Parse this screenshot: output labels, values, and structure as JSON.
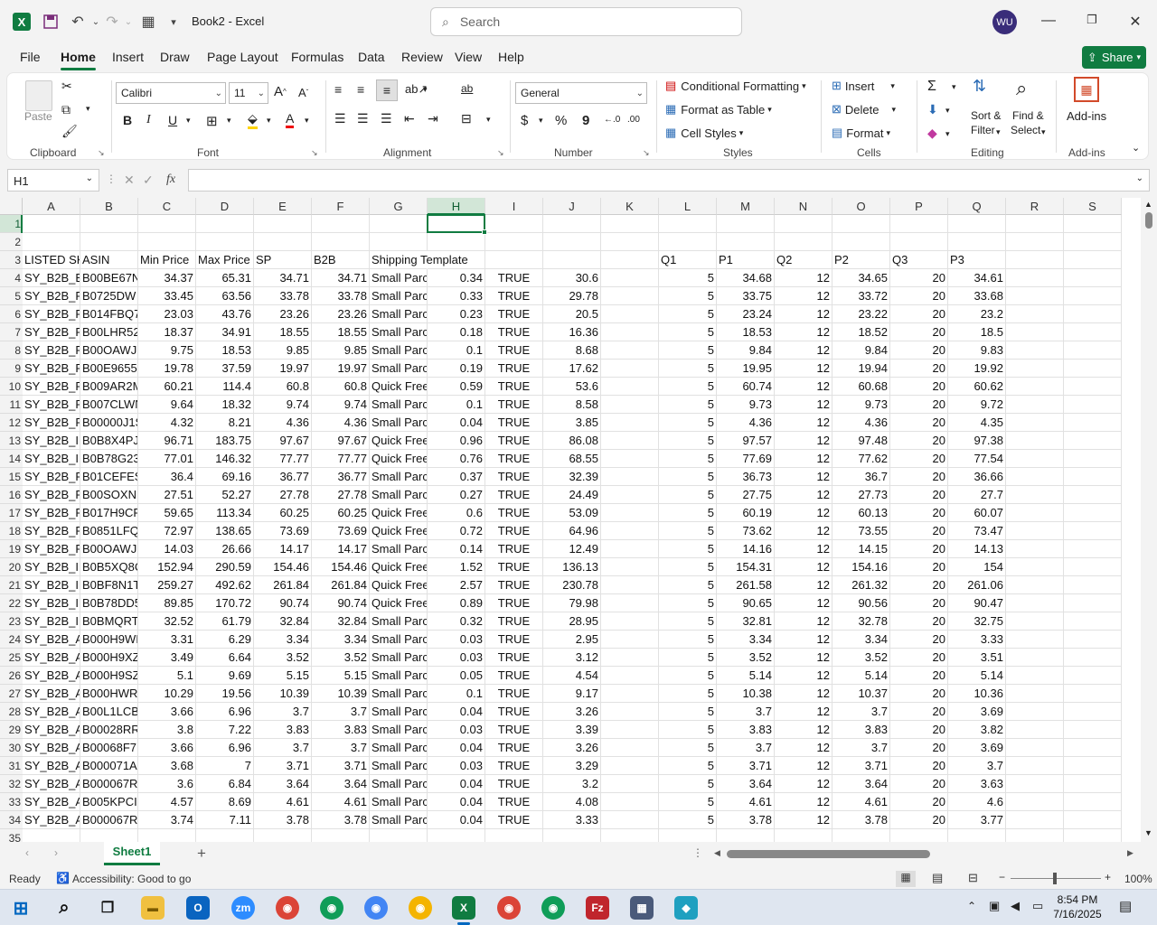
{
  "window": {
    "title": "Book2  -  Excel",
    "avatar": "WU"
  },
  "search": {
    "placeholder": "Search"
  },
  "menu": [
    "File",
    "Home",
    "Insert",
    "Draw",
    "Page Layout",
    "Formulas",
    "Data",
    "Review",
    "View",
    "Help"
  ],
  "share": "Share",
  "ribbon": {
    "clipboard": {
      "paste": "Paste",
      "label": "Clipboard"
    },
    "font": {
      "name": "Calibri",
      "size": "11",
      "label": "Font"
    },
    "alignment": {
      "label": "Alignment"
    },
    "number": {
      "format": "General",
      "label": "Number"
    },
    "styles": {
      "cond": "Conditional Formatting",
      "table": "Format as Table",
      "cell": "Cell Styles",
      "label": "Styles"
    },
    "cells": {
      "insert": "Insert",
      "delete": "Delete",
      "format": "Format",
      "label": "Cells"
    },
    "editing": {
      "sort": "Sort &",
      "sort2": "Filter",
      "find": "Find &",
      "find2": "Select",
      "label": "Editing"
    },
    "addins": {
      "btn": "Add-ins",
      "label": "Add-ins"
    }
  },
  "namebox": "H1",
  "columns": [
    "A",
    "B",
    "C",
    "D",
    "E",
    "F",
    "G",
    "H",
    "I",
    "J",
    "K",
    "L",
    "M",
    "N",
    "O",
    "P",
    "Q",
    "R",
    "S"
  ],
  "header_row": {
    "A": "LISTED SKU",
    "B": "ASIN",
    "C": "Min Price",
    "D": "Max Price",
    "E": "SP",
    "F": "B2B",
    "G": "Shipping Template",
    "L": "Q1",
    "M": "P1",
    "N": "Q2",
    "O": "P2",
    "P": "Q3",
    "Q": "P3"
  },
  "rows": [
    [
      "SY_B2B_B",
      "B00BE67N",
      "34.37",
      "65.31",
      "34.71",
      "34.71",
      "Small Parc",
      "0.34",
      "TRUE",
      "30.6",
      "",
      "5",
      "34.68",
      "12",
      "34.65",
      "20",
      "34.61"
    ],
    [
      "SY_B2B_F",
      "B0725DW",
      "33.45",
      "63.56",
      "33.78",
      "33.78",
      "Small Parc",
      "0.33",
      "TRUE",
      "29.78",
      "",
      "5",
      "33.75",
      "12",
      "33.72",
      "20",
      "33.68"
    ],
    [
      "SY_B2B_F",
      "B014FBQ7",
      "23.03",
      "43.76",
      "23.26",
      "23.26",
      "Small Parc",
      "0.23",
      "TRUE",
      "20.5",
      "",
      "5",
      "23.24",
      "12",
      "23.22",
      "20",
      "23.2"
    ],
    [
      "SY_B2B_F",
      "B00LHR52",
      "18.37",
      "34.91",
      "18.55",
      "18.55",
      "Small Parc",
      "0.18",
      "TRUE",
      "16.36",
      "",
      "5",
      "18.53",
      "12",
      "18.52",
      "20",
      "18.5"
    ],
    [
      "SY_B2B_F",
      "B00OAWJ",
      "9.75",
      "18.53",
      "9.85",
      "9.85",
      "Small Parc",
      "0.1",
      "TRUE",
      "8.68",
      "",
      "5",
      "9.84",
      "12",
      "9.84",
      "20",
      "9.83"
    ],
    [
      "SY_B2B_F",
      "B00E9655",
      "19.78",
      "37.59",
      "19.97",
      "19.97",
      "Small Parc",
      "0.19",
      "TRUE",
      "17.62",
      "",
      "5",
      "19.95",
      "12",
      "19.94",
      "20",
      "19.92"
    ],
    [
      "SY_B2B_F",
      "B009AR2M",
      "60.21",
      "114.4",
      "60.8",
      "60.8",
      "Quick Free",
      "0.59",
      "TRUE",
      "53.6",
      "",
      "5",
      "60.74",
      "12",
      "60.68",
      "20",
      "60.62"
    ],
    [
      "SY_B2B_F",
      "B007CLWN",
      "9.64",
      "18.32",
      "9.74",
      "9.74",
      "Small Parc",
      "0.1",
      "TRUE",
      "8.58",
      "",
      "5",
      "9.73",
      "12",
      "9.73",
      "20",
      "9.72"
    ],
    [
      "SY_B2B_F",
      "B00000J1S",
      "4.32",
      "8.21",
      "4.36",
      "4.36",
      "Small Parc",
      "0.04",
      "TRUE",
      "3.85",
      "",
      "5",
      "4.36",
      "12",
      "4.36",
      "20",
      "4.35"
    ],
    [
      "SY_B2B_IN",
      "B0B8X4PJ",
      "96.71",
      "183.75",
      "97.67",
      "97.67",
      "Quick Free",
      "0.96",
      "TRUE",
      "86.08",
      "",
      "5",
      "97.57",
      "12",
      "97.48",
      "20",
      "97.38"
    ],
    [
      "SY_B2B_IN",
      "B0B78G23",
      "77.01",
      "146.32",
      "77.77",
      "77.77",
      "Quick Free",
      "0.76",
      "TRUE",
      "68.55",
      "",
      "5",
      "77.69",
      "12",
      "77.62",
      "20",
      "77.54"
    ],
    [
      "SY_B2B_F",
      "B01CEFESI",
      "36.4",
      "69.16",
      "36.77",
      "36.77",
      "Small Parc",
      "0.37",
      "TRUE",
      "32.39",
      "",
      "5",
      "36.73",
      "12",
      "36.7",
      "20",
      "36.66"
    ],
    [
      "SY_B2B_F",
      "B00SOXN1",
      "27.51",
      "52.27",
      "27.78",
      "27.78",
      "Small Parc",
      "0.27",
      "TRUE",
      "24.49",
      "",
      "5",
      "27.75",
      "12",
      "27.73",
      "20",
      "27.7"
    ],
    [
      "SY_B2B_F",
      "B017H9CF",
      "59.65",
      "113.34",
      "60.25",
      "60.25",
      "Quick Free",
      "0.6",
      "TRUE",
      "53.09",
      "",
      "5",
      "60.19",
      "12",
      "60.13",
      "20",
      "60.07"
    ],
    [
      "SY_B2B_F",
      "B0851LFQ",
      "72.97",
      "138.65",
      "73.69",
      "73.69",
      "Quick Free",
      "0.72",
      "TRUE",
      "64.96",
      "",
      "5",
      "73.62",
      "12",
      "73.55",
      "20",
      "73.47"
    ],
    [
      "SY_B2B_F",
      "B00OAWJ",
      "14.03",
      "26.66",
      "14.17",
      "14.17",
      "Small Parc",
      "0.14",
      "TRUE",
      "12.49",
      "",
      "5",
      "14.16",
      "12",
      "14.15",
      "20",
      "14.13"
    ],
    [
      "SY_B2B_IN",
      "B0B5XQ8C",
      "152.94",
      "290.59",
      "154.46",
      "154.46",
      "Quick Free",
      "1.52",
      "TRUE",
      "136.13",
      "",
      "5",
      "154.31",
      "12",
      "154.16",
      "20",
      "154"
    ],
    [
      "SY_B2B_IN",
      "B0BF8N1T",
      "259.27",
      "492.62",
      "261.84",
      "261.84",
      "Quick Free",
      "2.57",
      "TRUE",
      "230.78",
      "",
      "5",
      "261.58",
      "12",
      "261.32",
      "20",
      "261.06"
    ],
    [
      "SY_B2B_IN",
      "B0B78DD5",
      "89.85",
      "170.72",
      "90.74",
      "90.74",
      "Quick Free",
      "0.89",
      "TRUE",
      "79.98",
      "",
      "5",
      "90.65",
      "12",
      "90.56",
      "20",
      "90.47"
    ],
    [
      "SY_B2B_IN",
      "B0BMQRT",
      "32.52",
      "61.79",
      "32.84",
      "32.84",
      "Small Parc",
      "0.32",
      "TRUE",
      "28.95",
      "",
      "5",
      "32.81",
      "12",
      "32.78",
      "20",
      "32.75"
    ],
    [
      "SY_B2B_A",
      "B000H9WI",
      "3.31",
      "6.29",
      "3.34",
      "3.34",
      "Small Parc",
      "0.03",
      "TRUE",
      "2.95",
      "",
      "5",
      "3.34",
      "12",
      "3.34",
      "20",
      "3.33"
    ],
    [
      "SY_B2B_A",
      "B000H9XZ",
      "3.49",
      "6.64",
      "3.52",
      "3.52",
      "Small Parc",
      "0.03",
      "TRUE",
      "3.12",
      "",
      "5",
      "3.52",
      "12",
      "3.52",
      "20",
      "3.51"
    ],
    [
      "SY_B2B_A",
      "B000H9SZ",
      "5.1",
      "9.69",
      "5.15",
      "5.15",
      "Small Parc",
      "0.05",
      "TRUE",
      "4.54",
      "",
      "5",
      "5.14",
      "12",
      "5.14",
      "20",
      "5.14"
    ],
    [
      "SY_B2B_A",
      "B000HWR",
      "10.29",
      "19.56",
      "10.39",
      "10.39",
      "Small Parc",
      "0.1",
      "TRUE",
      "9.17",
      "",
      "5",
      "10.38",
      "12",
      "10.37",
      "20",
      "10.36"
    ],
    [
      "SY_B2B_A",
      "B00L1LCB",
      "3.66",
      "6.96",
      "3.7",
      "3.7",
      "Small Parc",
      "0.04",
      "TRUE",
      "3.26",
      "",
      "5",
      "3.7",
      "12",
      "3.7",
      "20",
      "3.69"
    ],
    [
      "SY_B2B_A",
      "B00028RR",
      "3.8",
      "7.22",
      "3.83",
      "3.83",
      "Small Parc",
      "0.03",
      "TRUE",
      "3.39",
      "",
      "5",
      "3.83",
      "12",
      "3.83",
      "20",
      "3.82"
    ],
    [
      "SY_B2B_A",
      "B00068F7",
      "3.66",
      "6.96",
      "3.7",
      "3.7",
      "Small Parc",
      "0.04",
      "TRUE",
      "3.26",
      "",
      "5",
      "3.7",
      "12",
      "3.7",
      "20",
      "3.69"
    ],
    [
      "SY_B2B_A",
      "B000071A",
      "3.68",
      "7",
      "3.71",
      "3.71",
      "Small Parc",
      "0.03",
      "TRUE",
      "3.29",
      "",
      "5",
      "3.71",
      "12",
      "3.71",
      "20",
      "3.7"
    ],
    [
      "SY_B2B_A",
      "B000067R",
      "3.6",
      "6.84",
      "3.64",
      "3.64",
      "Small Parc",
      "0.04",
      "TRUE",
      "3.2",
      "",
      "5",
      "3.64",
      "12",
      "3.64",
      "20",
      "3.63"
    ],
    [
      "SY_B2B_A",
      "B005KPCI",
      "4.57",
      "8.69",
      "4.61",
      "4.61",
      "Small Parc",
      "0.04",
      "TRUE",
      "4.08",
      "",
      "5",
      "4.61",
      "12",
      "4.61",
      "20",
      "4.6"
    ],
    [
      "SY_B2B_A",
      "B000067R",
      "3.74",
      "7.11",
      "3.78",
      "3.78",
      "Small Parc",
      "0.04",
      "TRUE",
      "3.33",
      "",
      "5",
      "3.78",
      "12",
      "3.78",
      "20",
      "3.77"
    ]
  ],
  "sheet": {
    "tab": "Sheet1",
    "add": "+"
  },
  "status": {
    "ready": "Ready",
    "accessibility": "Accessibility: Good to go",
    "zoom": "100%"
  },
  "clock": {
    "time": "8:54 PM",
    "date": "7/16/2025"
  }
}
